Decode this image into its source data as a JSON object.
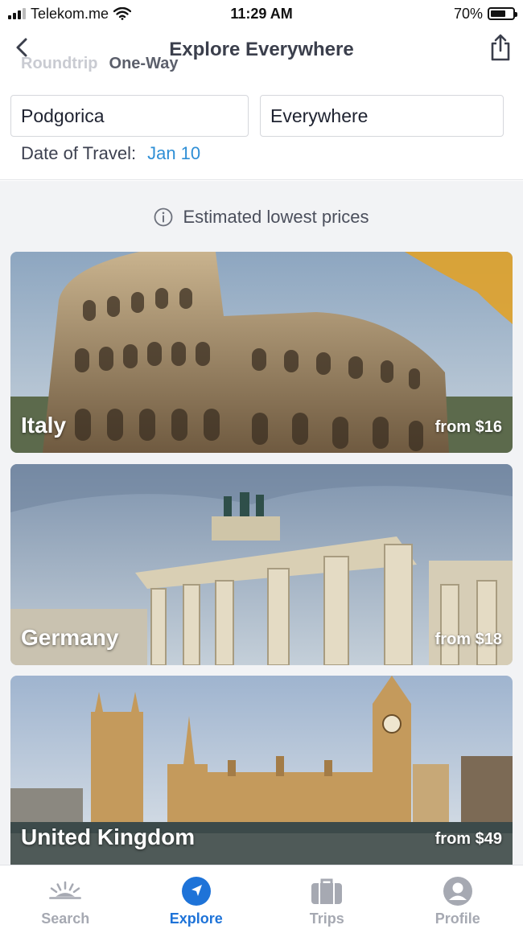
{
  "status_bar": {
    "carrier": "Telekom.me",
    "time": "11:29 AM",
    "battery": "70%",
    "battery_level": 0.7
  },
  "header": {
    "title": "Explore Everywhere",
    "back_icon": "chevron-left-icon",
    "share_icon": "share-icon"
  },
  "trip_type": {
    "roundtrip": "Roundtrip",
    "oneway": "One-Way"
  },
  "search": {
    "origin": "Podgorica",
    "destination": "Everywhere",
    "date_label": "Date of Travel:",
    "date_value": "Jan 10"
  },
  "notice": {
    "icon": "info-icon",
    "text": "Estimated lowest prices"
  },
  "destinations": [
    {
      "country": "Italy",
      "price": "from $16"
    },
    {
      "country": "Germany",
      "price": "from $18"
    },
    {
      "country": "United Kingdom",
      "price": "from $49"
    }
  ],
  "tabs": [
    {
      "label": "Search",
      "icon": "sunrise-icon"
    },
    {
      "label": "Explore",
      "icon": "compass-arrow-icon"
    },
    {
      "label": "Trips",
      "icon": "briefcase-icon"
    },
    {
      "label": "Profile",
      "icon": "profile-icon"
    }
  ],
  "colors": {
    "accent": "#1e73d8",
    "date_link": "#2f8fd6"
  }
}
